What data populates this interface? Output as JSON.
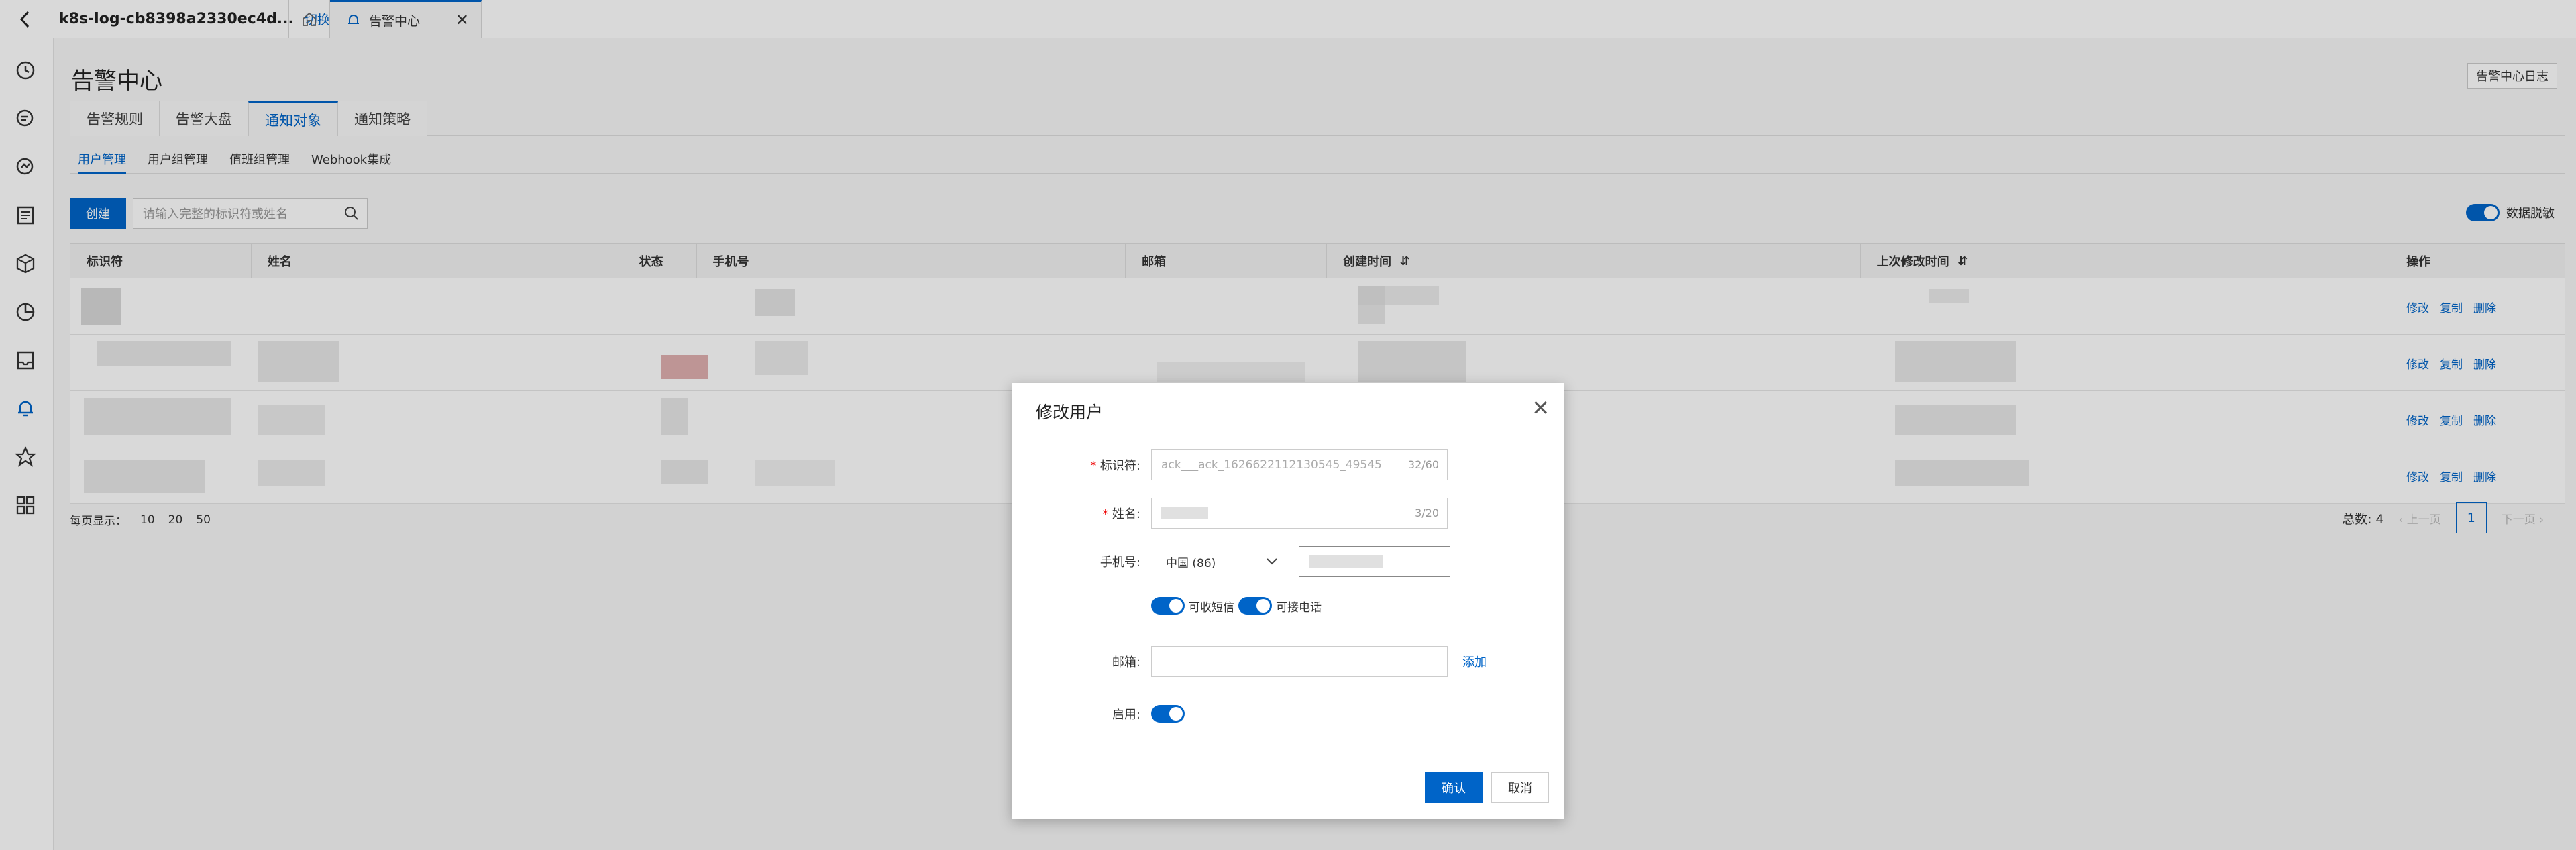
{
  "topbar": {
    "project_name": "k8s-log-cb8398a2330ec4d...",
    "switch_label": "切换",
    "current_tab": "告警中心"
  },
  "page": {
    "title": "告警中心",
    "log_button": "告警中心日志"
  },
  "tabs": [
    "告警规则",
    "告警大盘",
    "通知对象",
    "通知策略"
  ],
  "subtabs": [
    "用户管理",
    "用户组管理",
    "值班组管理",
    "Webhook集成"
  ],
  "toolbar": {
    "create_label": "创建",
    "search_placeholder": "请输入完整的标识符或姓名",
    "mask_label": "数据脱敏"
  },
  "table": {
    "columns": [
      "标识符",
      "姓名",
      "状态",
      "手机号",
      "邮箱",
      "创建时间",
      "上次修改时间",
      "操作"
    ],
    "row_actions": [
      "修改",
      "复制",
      "删除"
    ],
    "row_count": 4
  },
  "pager": {
    "per_page_label": "每页显示：",
    "sizes": [
      "10",
      "20",
      "50"
    ],
    "total": "总数: 4",
    "prev": "上一页",
    "current": "1",
    "next": "下一页"
  },
  "dialog": {
    "title": "修改用户",
    "id_label": "标识符:",
    "id_value": "ack___ack_1626622112130545_49545",
    "id_count": "32/60",
    "name_label": "姓名:",
    "name_count": "3/20",
    "phone_label": "手机号:",
    "country_code": "中国 (86)",
    "sms_label": "可收短信",
    "call_label": "可接电话",
    "email_label": "邮箱:",
    "add_label": "添加",
    "enable_label": "启用:",
    "confirm_label": "确认",
    "cancel_label": "取消"
  }
}
